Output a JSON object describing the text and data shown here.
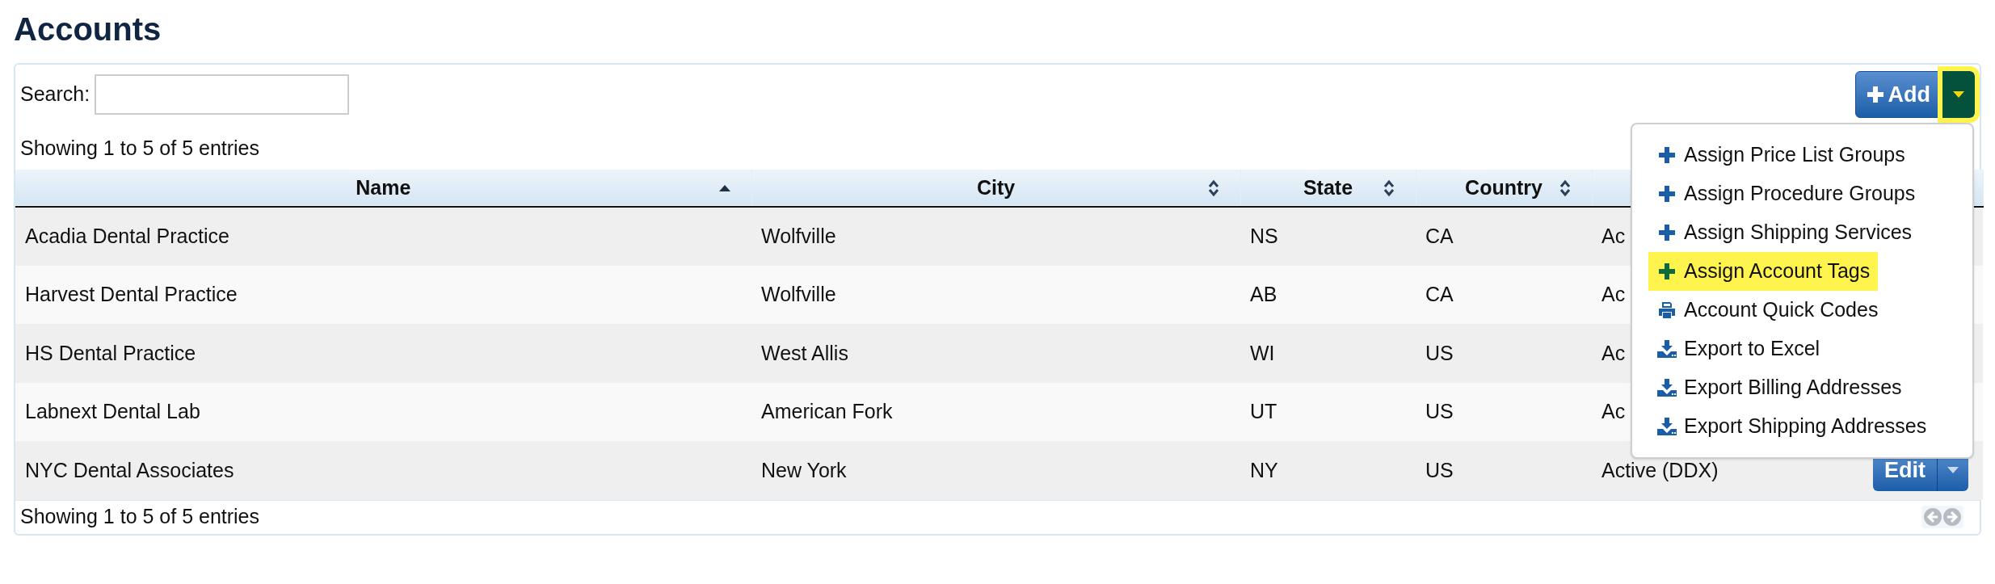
{
  "title": "Accounts",
  "search": {
    "label": "Search:"
  },
  "info_top": "Showing 1 to 5 of 5 entries",
  "add_button": {
    "label": "Add",
    "caret_highlighted": true
  },
  "table": {
    "columns": [
      {
        "label": "Name",
        "sorted_ascending": true
      },
      {
        "label": "City",
        "sorted_ascending": false
      },
      {
        "label": "State",
        "sorted_ascending": false
      },
      {
        "label": "Country",
        "sorted_ascending": false
      }
    ],
    "rows": [
      {
        "name": "Acadia Dental Practice",
        "city": "Wolfville",
        "state": "NS",
        "country": "CA",
        "status": "Ac"
      },
      {
        "name": "Harvest Dental Practice",
        "city": "Wolfville",
        "state": "AB",
        "country": "CA",
        "status": "Ac"
      },
      {
        "name": "HS Dental Practice",
        "city": "West Allis",
        "state": "WI",
        "country": "US",
        "status": "Ac"
      },
      {
        "name": "Labnext Dental Lab",
        "city": "American Fork",
        "state": "UT",
        "country": "US",
        "status": "Ac"
      },
      {
        "name": "NYC Dental Associates",
        "city": "New York",
        "state": "NY",
        "country": "US",
        "status": "Active (DDX)",
        "edit": "Edit"
      }
    ]
  },
  "menu": [
    {
      "kind": "plus",
      "label": "Assign Price List Groups",
      "highlighted": false
    },
    {
      "kind": "plus",
      "label": "Assign Procedure Groups",
      "highlighted": false
    },
    {
      "kind": "plus",
      "label": "Assign Shipping Services",
      "highlighted": false
    },
    {
      "kind": "plus",
      "label": "Assign Account Tags",
      "highlighted": true
    },
    {
      "kind": "print",
      "label": "Account Quick Codes",
      "highlighted": false
    },
    {
      "kind": "download",
      "label": "Export to Excel",
      "highlighted": false
    },
    {
      "kind": "download",
      "label": "Export Billing Addresses",
      "highlighted": false
    },
    {
      "kind": "download",
      "label": "Export Shipping Addresses",
      "highlighted": false
    }
  ],
  "info_bottom": "Showing 1 to 5 of 5 entries",
  "pagination": {
    "previous_disabled": true,
    "next_disabled": true
  }
}
